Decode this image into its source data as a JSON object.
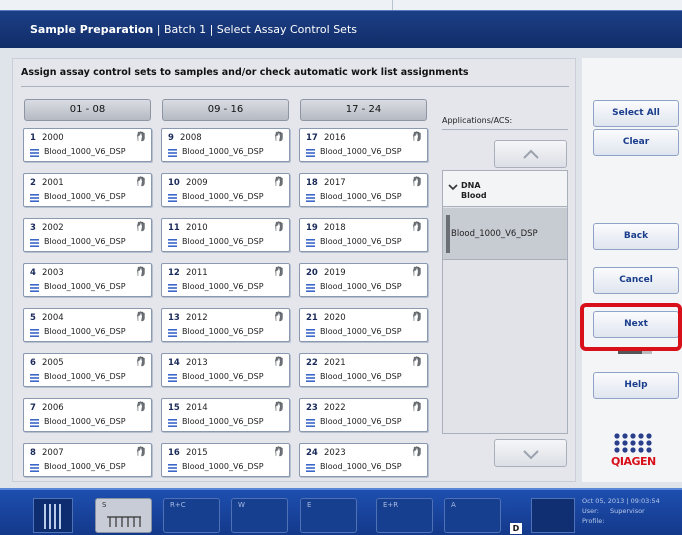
{
  "header": {
    "app": "Sample Preparation",
    "crumbs": " | Batch 1 | Select Assay Control Sets"
  },
  "main": {
    "title": "Assign assay control sets to samples and/or check automatic work list assignments",
    "columns": [
      "01 - 08",
      "09 - 16",
      "17 - 24"
    ],
    "tiles": [
      {
        "num": "1",
        "val": "2000",
        "acs": "Blood_1000_V6_DSP"
      },
      {
        "num": "2",
        "val": "2001",
        "acs": "Blood_1000_V6_DSP"
      },
      {
        "num": "3",
        "val": "2002",
        "acs": "Blood_1000_V6_DSP"
      },
      {
        "num": "4",
        "val": "2003",
        "acs": "Blood_1000_V6_DSP"
      },
      {
        "num": "5",
        "val": "2004",
        "acs": "Blood_1000_V6_DSP"
      },
      {
        "num": "6",
        "val": "2005",
        "acs": "Blood_1000_V6_DSP"
      },
      {
        "num": "7",
        "val": "2006",
        "acs": "Blood_1000_V6_DSP"
      },
      {
        "num": "8",
        "val": "2007",
        "acs": "Blood_1000_V6_DSP"
      },
      {
        "num": "9",
        "val": "2008",
        "acs": "Blood_1000_V6_DSP"
      },
      {
        "num": "10",
        "val": "2009",
        "acs": "Blood_1000_V6_DSP"
      },
      {
        "num": "11",
        "val": "2010",
        "acs": "Blood_1000_V6_DSP"
      },
      {
        "num": "12",
        "val": "2011",
        "acs": "Blood_1000_V6_DSP"
      },
      {
        "num": "13",
        "val": "2012",
        "acs": "Blood_1000_V6_DSP"
      },
      {
        "num": "14",
        "val": "2013",
        "acs": "Blood_1000_V6_DSP"
      },
      {
        "num": "15",
        "val": "2014",
        "acs": "Blood_1000_V6_DSP"
      },
      {
        "num": "16",
        "val": "2015",
        "acs": "Blood_1000_V6_DSP"
      },
      {
        "num": "17",
        "val": "2016",
        "acs": "Blood_1000_V6_DSP"
      },
      {
        "num": "18",
        "val": "2017",
        "acs": "Blood_1000_V6_DSP"
      },
      {
        "num": "19",
        "val": "2018",
        "acs": "Blood_1000_V6_DSP"
      },
      {
        "num": "20",
        "val": "2019",
        "acs": "Blood_1000_V6_DSP"
      },
      {
        "num": "21",
        "val": "2020",
        "acs": "Blood_1000_V6_DSP"
      },
      {
        "num": "22",
        "val": "2021",
        "acs": "Blood_1000_V6_DSP"
      },
      {
        "num": "23",
        "val": "2022",
        "acs": "Blood_1000_V6_DSP"
      },
      {
        "num": "24",
        "val": "2023",
        "acs": "Blood_1000_V6_DSP"
      }
    ]
  },
  "applications": {
    "label": "Applications/ACS:",
    "group_main": "DNA",
    "group_sub": "Blood",
    "item": "Blood_1000_V6_DSP"
  },
  "side": {
    "select_all": "Select All",
    "clear": "Clear",
    "back": "Back",
    "cancel": "Cancel",
    "next": "Next",
    "help": "Help",
    "logo": "QIAGEN"
  },
  "taskbar": {
    "buttons": [
      "S",
      "R+C",
      "W",
      "E",
      "E+R",
      "A"
    ],
    "d_marker": "D",
    "date": "Oct 05, 2013 | 09:03:54",
    "user_label": "User:",
    "user_value": "Supervisor",
    "profile_label": "Profile:"
  },
  "colors": {
    "header": "#1b3f86",
    "accent_red": "#d8101a",
    "button_text": "#1a3d8c",
    "taskbar": "#1d4fb0"
  }
}
